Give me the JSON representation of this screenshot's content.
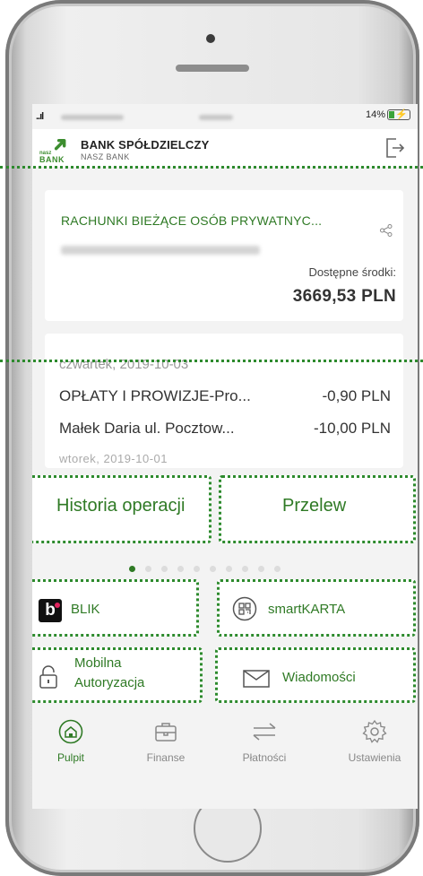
{
  "status_bar": {
    "signal": "..ıl",
    "battery_text": "14%"
  },
  "header": {
    "logo_small": "nasz",
    "logo_bank": "BANK",
    "bank_name": "BANK SPÓŁDZIELCZY",
    "bank_subtitle": "NASZ BANK"
  },
  "account": {
    "name": "RACHUNKI BIEŻĄCE OSÓB PRYWATNYC...",
    "funds_label": "Dostępne środki:",
    "funds_value": "3669,53 PLN"
  },
  "history": {
    "date1": "czwartek, 2019-10-03",
    "transactions": [
      {
        "desc": "OPŁATY I PROWIZJE-Pro...",
        "amount": "-0,90 PLN"
      },
      {
        "desc": "Małek Daria  ul. Pocztow...",
        "amount": "-10,00 PLN"
      }
    ],
    "date2": "wtorek, 2019-10-01"
  },
  "tiles": {
    "history_label": "Historia operacji",
    "transfer_label": "Przelew",
    "blik_label": "BLIK",
    "smartkarta_label": "smartKARTA",
    "mobile_auth_line1": "Mobilna",
    "mobile_auth_line2": "Autoryzacja",
    "messages_label": "Wiadomości"
  },
  "pager": {
    "total": 10,
    "active_index": 0
  },
  "bottom_nav": [
    {
      "label": "Pulpit",
      "icon": "home-icon",
      "active": true
    },
    {
      "label": "Finanse",
      "icon": "briefcase-icon",
      "active": false
    },
    {
      "label": "Płatności",
      "icon": "transfer-arrows-icon",
      "active": false
    },
    {
      "label": "Ustawienia",
      "icon": "gear-icon",
      "active": false
    }
  ],
  "colors": {
    "accent": "#2f7a25",
    "highlight_dots": "#2d8a2d"
  }
}
